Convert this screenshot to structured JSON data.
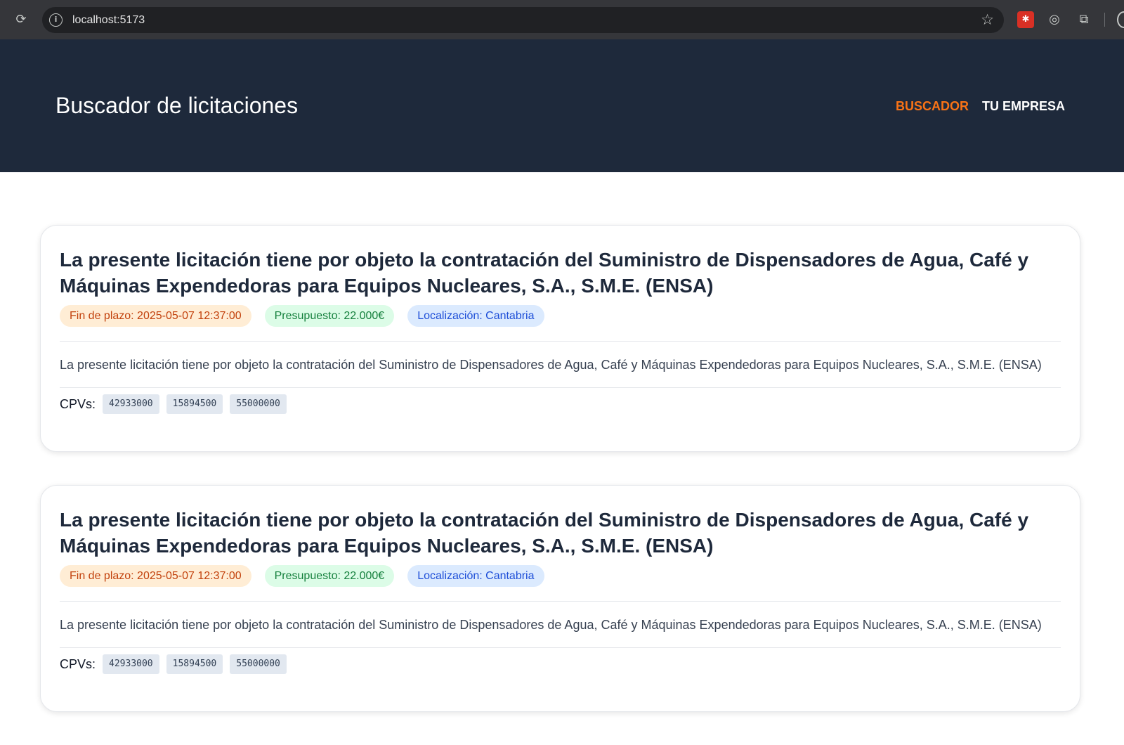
{
  "browser": {
    "url": "localhost:5173",
    "icons": [
      "reload-icon",
      "site-info-icon",
      "bookmark-star-icon",
      "extension-red-icon",
      "target-icon",
      "extensions-puzzle-icon"
    ]
  },
  "header": {
    "title": "Buscador de licitaciones",
    "nav": [
      {
        "label": "BUSCADOR",
        "active": true
      },
      {
        "label": "TU EMPRESA",
        "active": false
      }
    ],
    "colors": {
      "background": "#1e293b",
      "active": "#f97316"
    }
  },
  "tenders": [
    {
      "title": "La presente licitación tiene por objeto la contratación del Suministro de Dispensadores de Agua, Café y Máquinas Expendedoras para Equipos Nucleares, S.A., S.M.E. (ENSA)",
      "deadline": "Fin de plazo: 2025-05-07 12:37:00",
      "budget": "Presupuesto: 22.000€",
      "location": "Localización: Cantabria",
      "description": "La presente licitación tiene por objeto la contratación del Suministro de Dispensadores de Agua, Café y Máquinas Expendedoras para Equipos Nucleares, S.A., S.M.E. (ENSA)",
      "cpv_label": "CPVs:",
      "cpvs": [
        "42933000",
        "15894500",
        "55000000"
      ]
    },
    {
      "title": "La presente licitación tiene por objeto la contratación del Suministro de Dispensadores de Agua, Café y Máquinas Expendedoras para Equipos Nucleares, S.A., S.M.E. (ENSA)",
      "deadline": "Fin de plazo: 2025-05-07 12:37:00",
      "budget": "Presupuesto: 22.000€",
      "location": "Localización: Cantabria",
      "description": "La presente licitación tiene por objeto la contratación del Suministro de Dispensadores de Agua, Café y Máquinas Expendedoras para Equipos Nucleares, S.A., S.M.E. (ENSA)",
      "cpv_label": "CPVs:",
      "cpvs": [
        "42933000",
        "15894500",
        "55000000"
      ]
    }
  ]
}
